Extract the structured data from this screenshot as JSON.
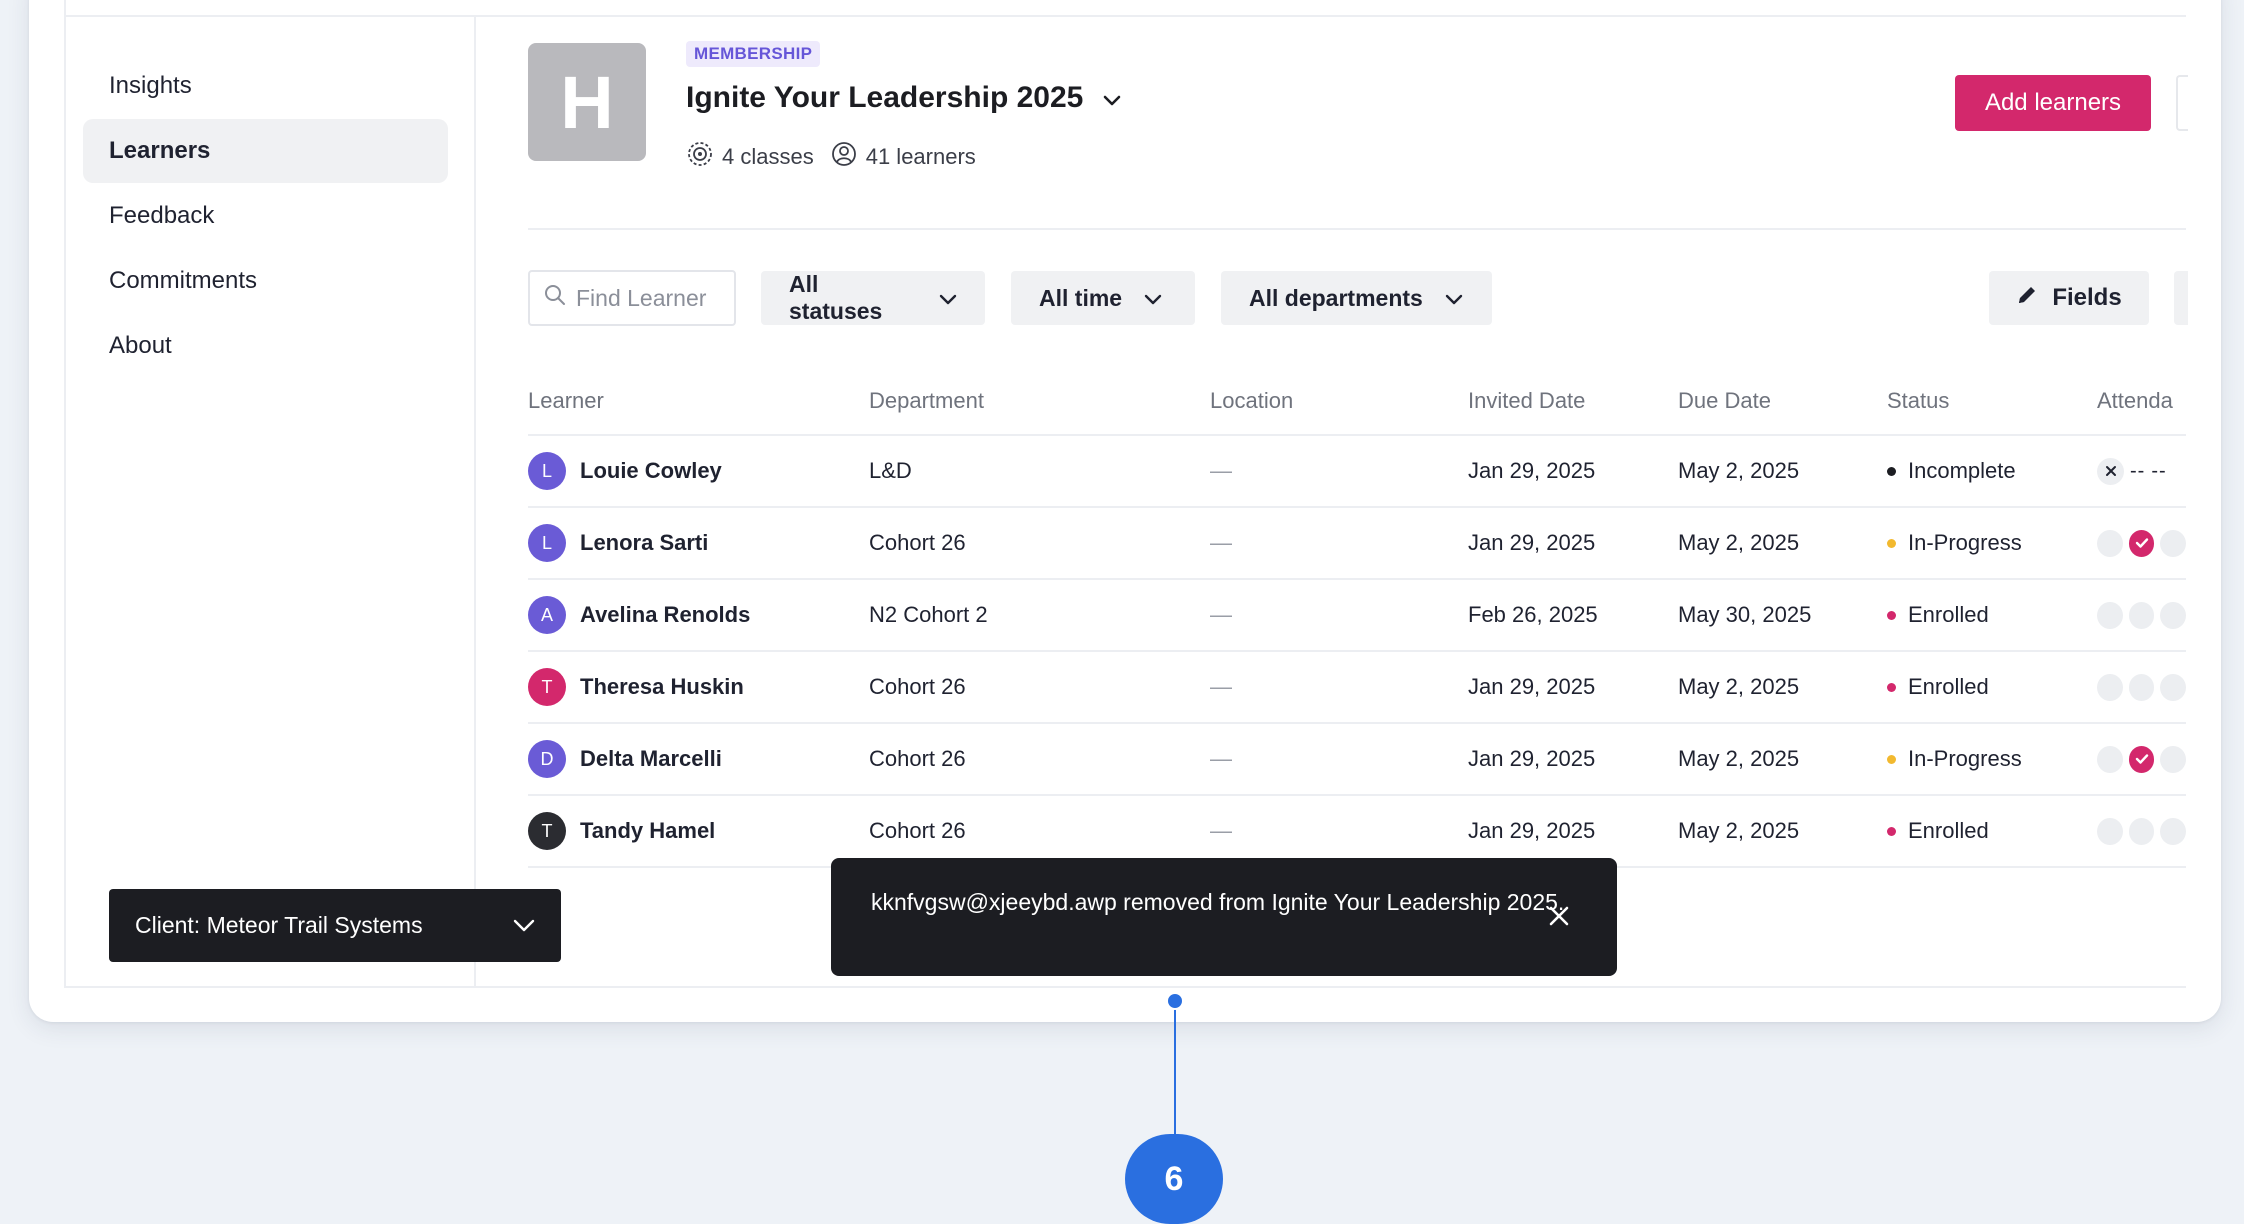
{
  "sidebar": {
    "items": [
      {
        "label": "Insights"
      },
      {
        "label": "Learners",
        "active": true
      },
      {
        "label": "Feedback"
      },
      {
        "label": "Commitments"
      },
      {
        "label": "About"
      }
    ],
    "client_select": "Client: Meteor Trail Systems"
  },
  "header": {
    "logo_letter": "H",
    "badge": "MEMBERSHIP",
    "title": "Ignite Your Leadership 2025",
    "classes": "4 classes",
    "learners": "41 learners",
    "add_button": "Add learners"
  },
  "filters": {
    "search_placeholder": "Find Learner",
    "status": "All statuses",
    "time": "All time",
    "department": "All departments",
    "fields_button": "Fields"
  },
  "table": {
    "columns": {
      "learner": "Learner",
      "department": "Department",
      "location": "Location",
      "invited": "Invited Date",
      "due": "Due Date",
      "status": "Status",
      "attendance": "Attenda"
    },
    "rows": [
      {
        "initial": "L",
        "avatar_color": "#6a5bd6",
        "name": "Louie Cowley",
        "department": "L&D",
        "location": "—",
        "invited": "Jan 29, 2025",
        "due": "May 2, 2025",
        "status": "Incomplete",
        "status_color": "#1c1d22",
        "attendance": [
          "x",
          "--",
          "--"
        ]
      },
      {
        "initial": "L",
        "avatar_color": "#6a5bd6",
        "name": "Lenora Sarti",
        "department": "Cohort 26",
        "location": "—",
        "invited": "Jan 29, 2025",
        "due": "May 2, 2025",
        "status": "In-Progress",
        "status_color": "#f2b92f",
        "attendance": [
          "empty",
          "check",
          "empty"
        ]
      },
      {
        "initial": "A",
        "avatar_color": "#6a5bd6",
        "name": "Avelina Renolds",
        "department": "N2 Cohort 2",
        "location": "—",
        "invited": "Feb 26, 2025",
        "due": "May 30, 2025",
        "status": "Enrolled",
        "status_color": "#d3286c",
        "attendance": [
          "empty",
          "empty",
          "empty"
        ]
      },
      {
        "initial": "T",
        "avatar_color": "#d3286c",
        "name": "Theresa Huskin",
        "department": "Cohort 26",
        "location": "—",
        "invited": "Jan 29, 2025",
        "due": "May 2, 2025",
        "status": "Enrolled",
        "status_color": "#d3286c",
        "attendance": [
          "empty",
          "empty",
          "empty"
        ]
      },
      {
        "initial": "D",
        "avatar_color": "#6a5bd6",
        "name": "Delta Marcelli",
        "department": "Cohort 26",
        "location": "—",
        "invited": "Jan 29, 2025",
        "due": "May 2, 2025",
        "status": "In-Progress",
        "status_color": "#f2b92f",
        "attendance": [
          "empty",
          "check",
          "empty"
        ]
      },
      {
        "initial": "T",
        "avatar_color": "#2b2c31",
        "name": "Tandy Hamel",
        "department": "Cohort 26",
        "location": "—",
        "invited": "Jan 29, 2025",
        "due": "May 2, 2025",
        "status": "Enrolled",
        "status_color": "#d3286c",
        "attendance": [
          "empty",
          "empty",
          "empty"
        ]
      }
    ]
  },
  "toast": {
    "message": "kknfvgsw@xjeeybd.awp removed from Ignite Your Leadership 2025."
  },
  "callout": {
    "number": "6"
  }
}
